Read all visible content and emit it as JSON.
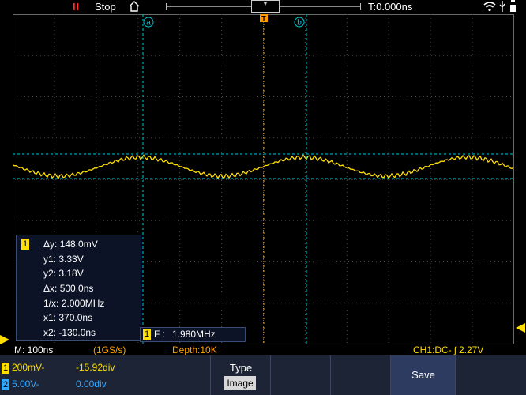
{
  "status": {
    "run_state": "Stop",
    "trigger_time": "T:0.000ns"
  },
  "cursors": {
    "a_label": "a",
    "b_label": "b",
    "trigger_marker": "T"
  },
  "cursor_panel": {
    "channel": "1",
    "dy": "148.0mV",
    "y1": "3.33V",
    "y2": "3.18V",
    "dx": "500.0ns",
    "inv_x": "2.000MHz",
    "x1": "370.0ns",
    "x2": "-130.0ns",
    "labels": {
      "dy": "Δy:",
      "y1": "y1:",
      "y2": "y2:",
      "dx": "Δx:",
      "inv_x": "1/x:",
      "x1": "x1:",
      "x2": "x2:"
    }
  },
  "freq_panel": {
    "channel": "1",
    "label": "F :",
    "value": "1.980MHz"
  },
  "bottom_status": {
    "timebase": "M: 100ns",
    "sample_rate": "(1GS/s)",
    "depth": "Depth:10K",
    "trigger": "CH1:DC- ʃ 2.27V"
  },
  "channels": [
    {
      "badge": "1",
      "scale": "200mV-",
      "offset": "-15.92div",
      "color": "#ffde00"
    },
    {
      "badge": "2",
      "scale": "5.00V-",
      "offset": "0.00div",
      "color": "#33a8ff"
    }
  ],
  "softkeys": {
    "type_label": "Type",
    "type_value": "Image",
    "save_label": "Save"
  },
  "colors": {
    "ch1": "#ffde00",
    "cursor": "#00c8d8",
    "trigger": "#ff9a00",
    "grid": "#5a5a5a"
  },
  "icons": [
    "home-icon",
    "wifi-icon",
    "usb-icon",
    "battery-icon"
  ]
}
